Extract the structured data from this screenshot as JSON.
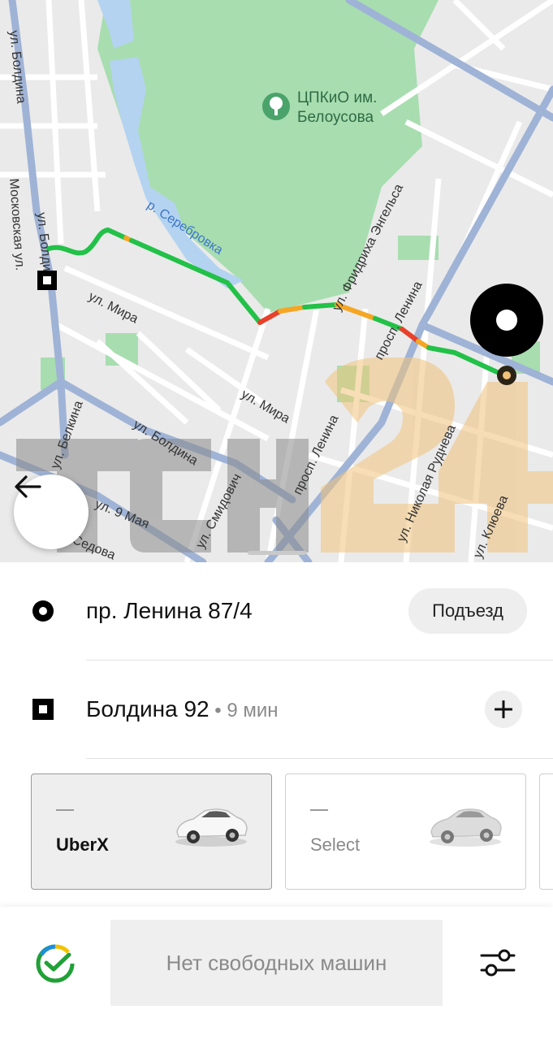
{
  "map": {
    "park_name_line1": "ЦПКиО им.",
    "park_name_line2": "Белоусова",
    "streets": {
      "boldina_top": "ул. Болдина",
      "moskovskaya": "Московская ул.",
      "boldina_left": "ул. Болдина",
      "serebrovka": "р. Серебровка",
      "engelsa": "ул. Фридриха Энгельса",
      "mira_left": "ул. Мира",
      "mira_center": "ул. Мира",
      "lenina_upper": "просп. Ленина",
      "lenina_lower": "просп. Ленина",
      "belkina": "ул. Белкина",
      "boldina_lower": "ул. Болдина",
      "devyatogo_maya": "ул. 9 Мая",
      "sedova": "Седова",
      "smidovich": "ул. Смидович",
      "rudneva": "ул. Николая Руднева",
      "klyueva": "ул. Клюева"
    },
    "watermark": "TCH24"
  },
  "colors": {
    "route_green": "#22c148",
    "route_orange": "#f5a623",
    "route_red": "#e8402a",
    "park_green": "#a8ddb0",
    "road_blue": "#9fb3d6"
  },
  "pickup": {
    "address": "пр. Ленина 87/4",
    "entrance_label": "Подъезд"
  },
  "destination": {
    "address": "Болдина 92",
    "eta": " • 9 мин"
  },
  "ride_options": [
    {
      "dash": "—",
      "name": "UberX",
      "icon": "car-icon"
    },
    {
      "dash": "—",
      "name": "Select",
      "icon": "car-icon"
    }
  ],
  "bottom": {
    "status": "Нет свободных машин",
    "logo": "sber-logo",
    "settings_icon": "filter-sliders-icon"
  }
}
